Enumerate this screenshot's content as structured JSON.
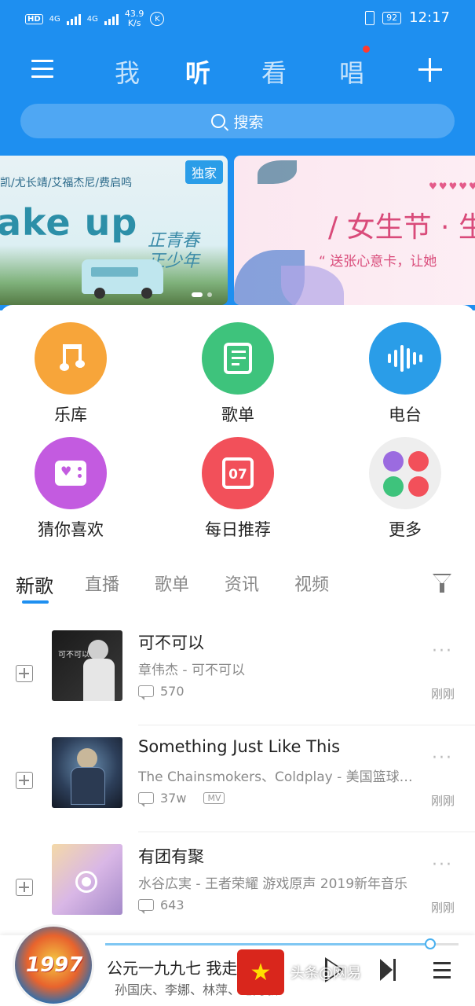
{
  "status_bar": {
    "network": "4G",
    "speed_value": "43.9",
    "speed_unit": "K/s",
    "k_label": "K",
    "battery": "92",
    "time": "12:17"
  },
  "nav": {
    "tabs": [
      "我",
      "听",
      "看",
      "唱"
    ],
    "active_tab": "听"
  },
  "search": {
    "placeholder": "搜索"
  },
  "banners": [
    {
      "artists": "凯/尤长靖/艾福杰尼/费启鸣",
      "title": "ake up",
      "calligraphy": "正青春 正少年",
      "badge": "独家"
    },
    {
      "headline": "/ 女生节 · 生",
      "subtitle": "“ 送张心意卡，让她"
    }
  ],
  "grid": [
    {
      "label": "乐库",
      "color": "#f7a53a",
      "icon": "music-note-icon"
    },
    {
      "label": "歌单",
      "color": "#3ec37c",
      "icon": "playlist-icon"
    },
    {
      "label": "电台",
      "color": "#2a9de8",
      "icon": "sound-wave-icon"
    },
    {
      "label": "猜你喜欢",
      "color": "#c35be0",
      "icon": "radio-heart-icon"
    },
    {
      "label": "每日推荐",
      "color": "#f2505a",
      "icon": "calendar-icon",
      "day": "07"
    },
    {
      "label": "更多",
      "color": "#eeeeee",
      "icon": "more-apps-icon"
    }
  ],
  "tabs": [
    "新歌",
    "直播",
    "歌单",
    "资讯",
    "视频"
  ],
  "songs": [
    {
      "title": "可不可以",
      "artist": "章伟杰 - 可不可以",
      "comments": "570",
      "time": "刚刚",
      "cover_text": "可不可以"
    },
    {
      "title": "Something Just Like This",
      "artist": "The Chainsmokers、Coldplay - 美国篮球联…",
      "comments": "37w",
      "mv": "MV",
      "time": "刚刚"
    },
    {
      "title": "有团有聚",
      "artist": "水谷広実 - 王者荣耀 游戏原声 2019新年音乐",
      "comments": "643",
      "time": "刚刚"
    }
  ],
  "player": {
    "title": "公元一九九七 我走近你",
    "artist": "孙国庆、李娜、林萍、毛阿敏",
    "disc_text": "1997",
    "progress": 0.92
  },
  "watermark": {
    "text": "头条@网易"
  },
  "colors": {
    "brand": "#1e8ff0"
  }
}
